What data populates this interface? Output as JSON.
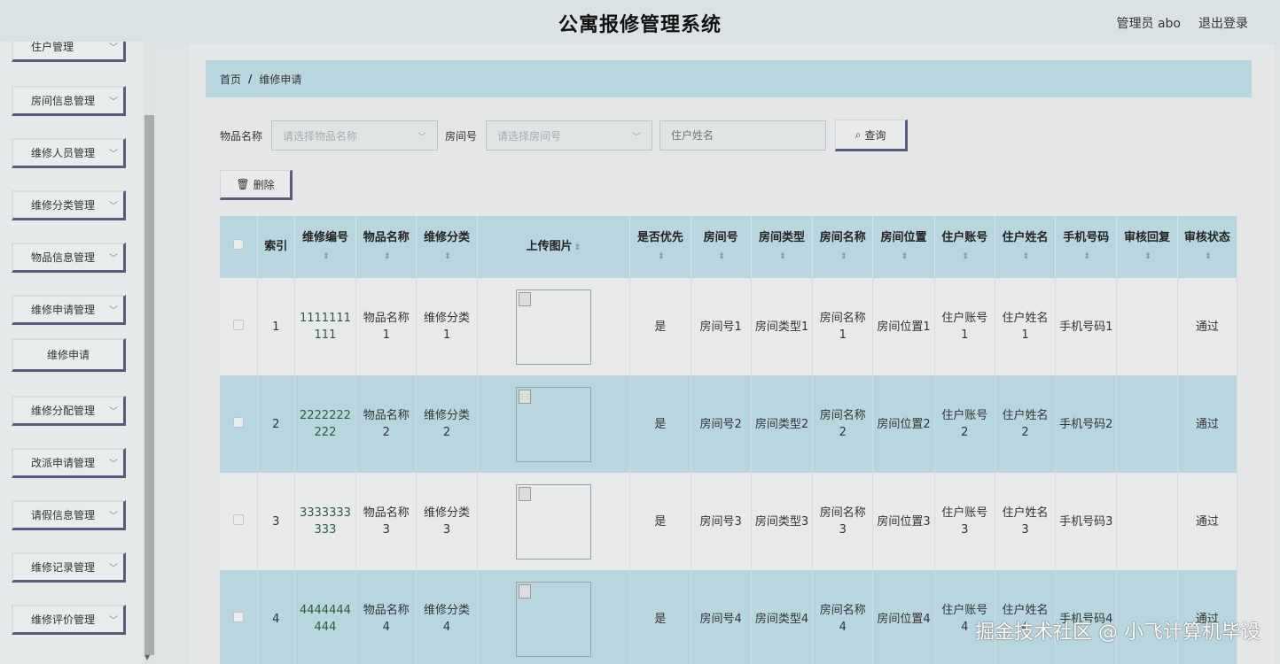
{
  "header": {
    "title": "公寓报修管理系统",
    "user": "管理员 abo",
    "logout": "退出登录"
  },
  "sidebar": {
    "items": [
      {
        "label": "住户管理"
      },
      {
        "label": "房间信息管理"
      },
      {
        "label": "维修人员管理"
      },
      {
        "label": "维修分类管理"
      },
      {
        "label": "物品信息管理"
      },
      {
        "label": "维修申请管理"
      },
      {
        "label": "维修分配管理"
      },
      {
        "label": "改派申请管理"
      },
      {
        "label": "请假信息管理"
      },
      {
        "label": "维修记录管理"
      },
      {
        "label": "维修评价管理"
      }
    ],
    "sub_item": "维修申请"
  },
  "breadcrumb": {
    "home": "首页",
    "separator": "/",
    "current": "维修申请"
  },
  "search": {
    "item_label": "物品名称",
    "item_placeholder": "请选择物品名称",
    "room_label": "房间号",
    "room_placeholder": "请选择房间号",
    "name_placeholder": "住户姓名",
    "query": "查询"
  },
  "actions": {
    "delete": "删除"
  },
  "table": {
    "headers": [
      "索引",
      "维修编号",
      "物品名称",
      "维修分类",
      "上传图片",
      "是否优先",
      "房间号",
      "房间类型",
      "房间名称",
      "房间位置",
      "住户账号",
      "住户姓名",
      "手机号码",
      "审核回复",
      "审核状态"
    ],
    "rows": [
      {
        "index": "1",
        "code": "1111111111",
        "item": "物品名称1",
        "category": "维修分类1",
        "priority": "是",
        "room_no": "房间号1",
        "room_type": "房间类型1",
        "room_name": "房间名称1",
        "room_loc": "房间位置1",
        "account": "住户账号1",
        "name": "住户姓名1",
        "phone": "手机号码1",
        "reply": "",
        "status": "通过"
      },
      {
        "index": "2",
        "code": "2222222222",
        "item": "物品名称2",
        "category": "维修分类2",
        "priority": "是",
        "room_no": "房间号2",
        "room_type": "房间类型2",
        "room_name": "房间名称2",
        "room_loc": "房间位置2",
        "account": "住户账号2",
        "name": "住户姓名2",
        "phone": "手机号码2",
        "reply": "",
        "status": "通过"
      },
      {
        "index": "3",
        "code": "3333333333",
        "item": "物品名称3",
        "category": "维修分类3",
        "priority": "是",
        "room_no": "房间号3",
        "room_type": "房间类型3",
        "room_name": "房间名称3",
        "room_loc": "房间位置3",
        "account": "住户账号3",
        "name": "住户姓名3",
        "phone": "手机号码3",
        "reply": "",
        "status": "通过"
      },
      {
        "index": "4",
        "code": "4444444444",
        "item": "物品名称4",
        "category": "维修分类4",
        "priority": "是",
        "room_no": "房间号4",
        "room_type": "房间类型4",
        "room_name": "房间名称4",
        "room_loc": "房间位置4",
        "account": "住户账号4",
        "name": "住户姓名4",
        "phone": "手机号码4",
        "reply": "",
        "status": "通过"
      }
    ]
  },
  "watermark": "掘金技术社区 @ 小飞计算机毕设"
}
